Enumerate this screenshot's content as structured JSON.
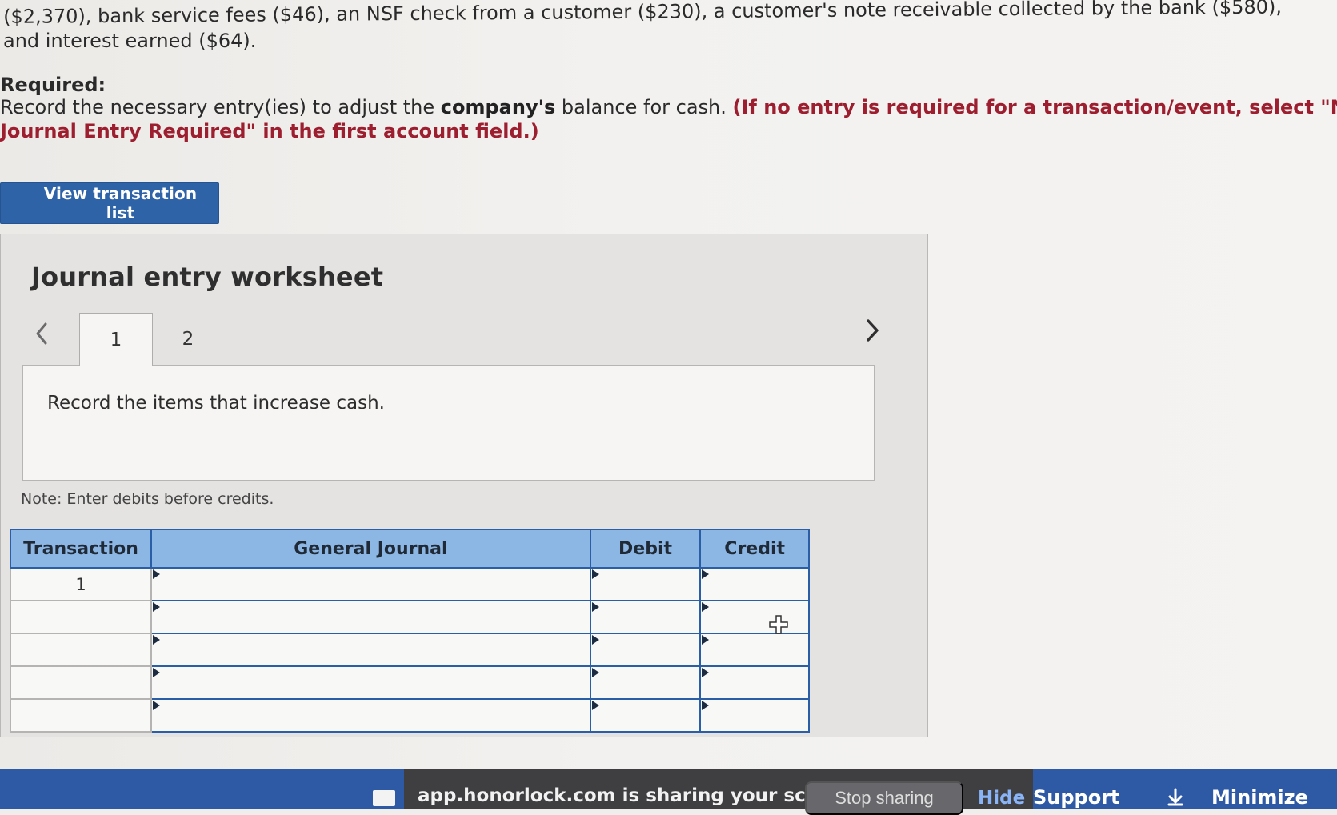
{
  "problem": {
    "line1": "($2,370), bank service fees ($46), an NSF check from a customer ($230), a customer's note receivable collected by the bank ($580),",
    "line2": "and interest earned ($64)."
  },
  "required": {
    "title": "Required:",
    "line1_before": "Record the necessary entry(ies) to adjust the ",
    "line1_bold": "company's",
    "line1_after": " balance for cash. ",
    "line1_red": "(If no entry is required for a transaction/event, select \"No",
    "line2_red": "Journal Entry Required\" in the first account field.)"
  },
  "buttons": {
    "view_transaction_list": "View transaction list"
  },
  "worksheet": {
    "title": "Journal entry worksheet",
    "tabs": [
      "1",
      "2"
    ],
    "instruction": "Record the items that increase cash.",
    "note": "Note: Enter debits before credits."
  },
  "table": {
    "headers": [
      "Transaction",
      "General Journal",
      "Debit",
      "Credit"
    ],
    "rows": [
      {
        "transaction": "1",
        "general_journal": "",
        "debit": "",
        "credit": ""
      },
      {
        "transaction": "",
        "general_journal": "",
        "debit": "",
        "credit": ""
      },
      {
        "transaction": "",
        "general_journal": "",
        "debit": "",
        "credit": ""
      },
      {
        "transaction": "",
        "general_journal": "",
        "debit": "",
        "credit": ""
      },
      {
        "transaction": "",
        "general_journal": "",
        "debit": "",
        "credit": ""
      }
    ]
  },
  "sharing_bar": {
    "message": "app.honorlock.com is sharing your screen.",
    "stop_sharing": "Stop sharing",
    "hide": "Hide",
    "support": "Support",
    "minimize": "Minimize"
  },
  "icons": {
    "prev": "chevron-left-icon",
    "next": "chevron-right-icon",
    "cursor": "plus-cursor-icon",
    "share": "screen-share-icon",
    "minimize": "download-arrow-icon"
  },
  "colors": {
    "button_blue": "#2f63a8",
    "table_header_blue": "#8cb6e3",
    "table_border_blue": "#2a5fa7",
    "instruction_red": "#9d1e2f",
    "sharing_blue": "#2e5aa5"
  }
}
